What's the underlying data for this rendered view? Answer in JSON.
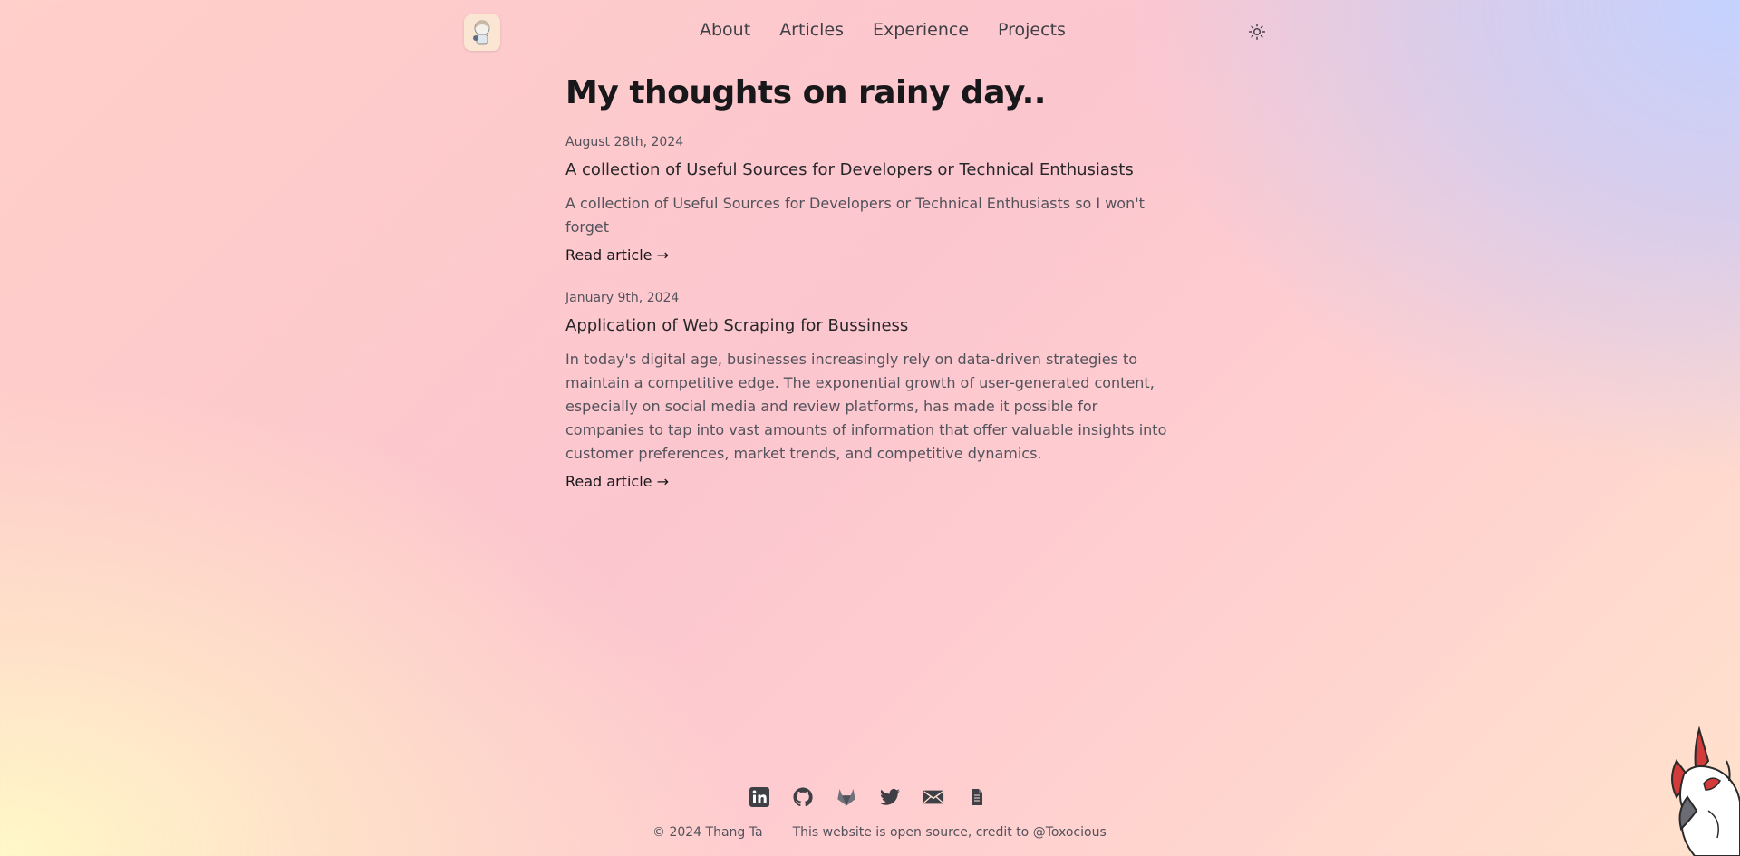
{
  "header": {
    "nav": [
      {
        "label": "About"
      },
      {
        "label": "Articles"
      },
      {
        "label": "Experience"
      },
      {
        "label": "Projects"
      }
    ]
  },
  "main": {
    "title": "My thoughts on rainy day..",
    "articles": [
      {
        "date": "August 28th, 2024",
        "title": "A collection of Useful Sources for Developers or Technical Enthusiasts",
        "description": "A collection of Useful Sources for Developers or Technical Enthusiasts so I won't forget",
        "link": "Read article →"
      },
      {
        "date": "January 9th, 2024",
        "title": "Application of Web Scraping for Bussiness",
        "description": "In today's digital age, businesses increasingly rely on data-driven strategies to maintain a competitive edge. The exponential growth of user-generated content, especially on social media and review platforms, has made it possible for companies to tap into vast amounts of information that offer valuable insights into customer preferences, market trends, and competitive dynamics.",
        "link": "Read article →"
      }
    ]
  },
  "footer": {
    "icons": [
      "linkedin-icon",
      "github-icon",
      "gitlab-icon",
      "twitter-icon",
      "mail-icon",
      "document-icon"
    ],
    "copyright": "© 2024 Thang Ta",
    "credit": "This website is open source, credit to @Toxocious"
  },
  "colors": {
    "text": "#18181b",
    "muted": "#52525b",
    "icon": "#3f3f46"
  }
}
